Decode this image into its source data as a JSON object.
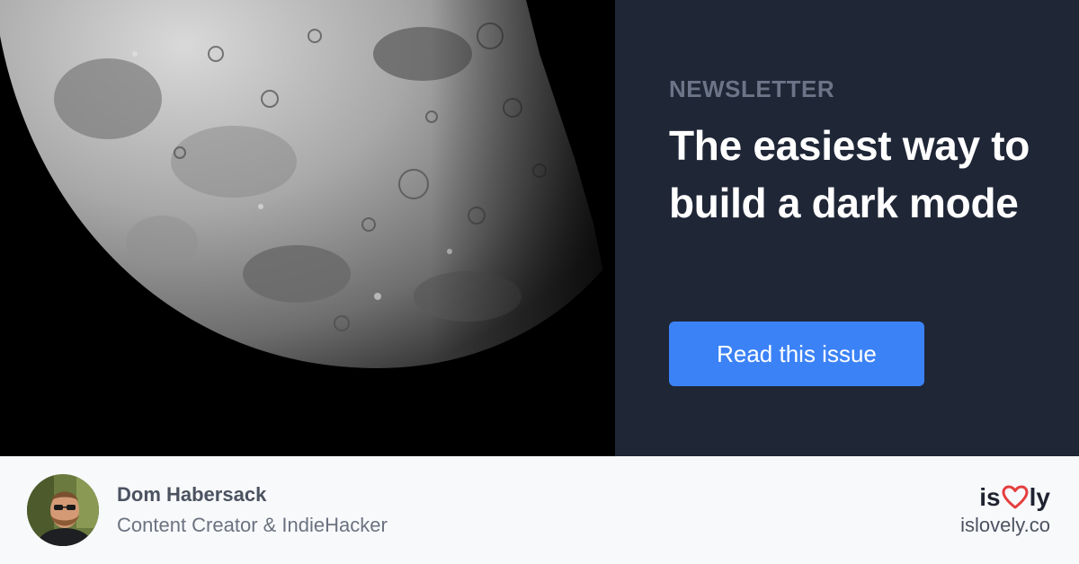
{
  "hero": {
    "kicker": "NEWSLETTER",
    "headline": "The easiest way to build a dark mode",
    "cta_label": "Read this issue"
  },
  "author": {
    "name": "Dom Habersack",
    "role": "Content Creator & IndieHacker"
  },
  "brand": {
    "prefix": "is",
    "suffix": "ly",
    "url": "islovely.co"
  },
  "colors": {
    "panel": "#1f2636",
    "accent": "#3b82f6",
    "heart": "#e53e3e"
  }
}
